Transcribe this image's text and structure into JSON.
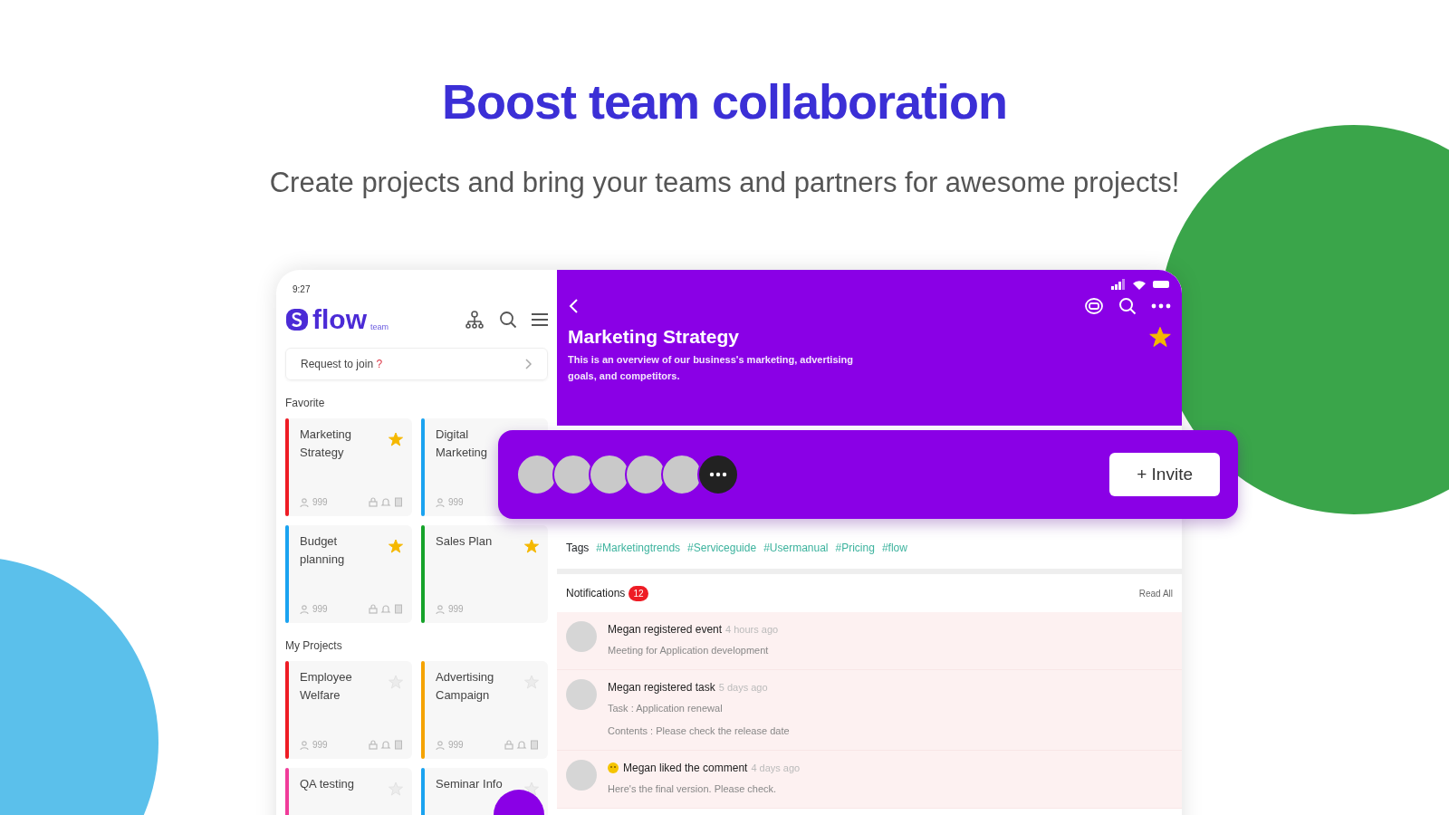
{
  "headline": "Boost team collaboration",
  "subheadline": "Create projects and bring your teams and partners for awesome projects!",
  "app": {
    "status_time": "9:27",
    "logo": {
      "name": "flow",
      "suffix": "team"
    },
    "request_to_join": {
      "label": "Request to join",
      "mark": "?"
    },
    "sections": [
      {
        "title": "Favorite",
        "projects": [
          {
            "name": "Marketing Strategy",
            "color": "#ee1c25",
            "starred": true,
            "members": "999",
            "stats": true
          },
          {
            "name": "Digital Marketing",
            "color": "#1aa3f0",
            "members": "999",
            "stats": false
          },
          {
            "name": "Budget planning",
            "color": "#1aa3f0",
            "starred": true,
            "members": "999",
            "stats": true
          },
          {
            "name": "Sales Plan",
            "color": "#16a32a",
            "starred": true,
            "members": "999",
            "stats": false
          }
        ]
      },
      {
        "title": "My Projects",
        "projects": [
          {
            "name": "Employee Welfare",
            "color": "#ee1c25",
            "starred": false,
            "members": "999",
            "stats": true
          },
          {
            "name": "Advertising Campaign",
            "color": "#f5a300",
            "starred": false,
            "members": "999",
            "stats": true
          },
          {
            "name": "QA testing",
            "color": "#f03c9a",
            "starred": false
          },
          {
            "name": "Seminar Info",
            "color": "#1aa3f0",
            "starred": false
          }
        ]
      }
    ]
  },
  "detail": {
    "title": "Marketing Strategy",
    "description": "This is an overview of our business's marketing, advertising goals, and competitors.",
    "starred": true,
    "invite_button": "+ Invite",
    "tags_label": "Tags",
    "tags": [
      "#Marketingtrends",
      "#Serviceguide",
      "#Usermanual",
      "#Pricing",
      "#flow"
    ],
    "notifications": {
      "title": "Notifications",
      "count": "12",
      "read_all": "Read All",
      "items": [
        {
          "kind": "event",
          "title": "Megan registered event",
          "time": "4 hours ago",
          "lines": [
            "Meeting for Application development"
          ]
        },
        {
          "kind": "task",
          "title": "Megan registered task",
          "time": "5 days ago",
          "lines": [
            "Task : Application renewal",
            "Contents : Please check the release date"
          ]
        },
        {
          "kind": "like",
          "title": "Megan liked the comment",
          "time": "4 days ago",
          "lines": [
            "Here's the final version. Please check."
          ]
        }
      ]
    }
  }
}
